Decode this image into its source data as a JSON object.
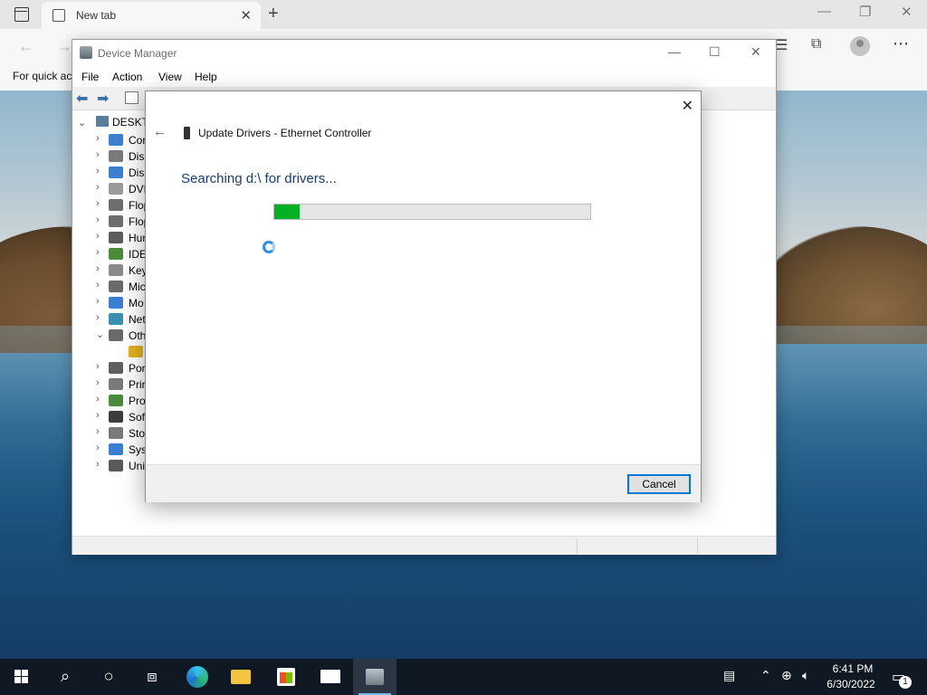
{
  "browser": {
    "tab_label": "New tab",
    "tab_close": "✕",
    "new_tab": "+",
    "favorites_text": "For quick ac"
  },
  "device_manager": {
    "title": "Device Manager",
    "menu": [
      "File",
      "Action",
      "View",
      "Help"
    ],
    "tree_root": "DESKTO",
    "tree_items": [
      {
        "label": "Cor",
        "chevron": "›",
        "icon_color": "#3c7fd1"
      },
      {
        "label": "Disl",
        "chevron": "›",
        "icon_color": "#7a7a7a"
      },
      {
        "label": "Disp",
        "chevron": "›",
        "icon_color": "#3c7fd1"
      },
      {
        "label": "DVD",
        "chevron": "›",
        "icon_color": "#9a9a9a"
      },
      {
        "label": "Flop",
        "chevron": "›",
        "icon_color": "#6e6e6e"
      },
      {
        "label": "Flop",
        "chevron": "›",
        "icon_color": "#6e6e6e"
      },
      {
        "label": "Hur",
        "chevron": "›",
        "icon_color": "#5b5b5b"
      },
      {
        "label": "IDE",
        "chevron": "›",
        "icon_color": "#4c8a3c"
      },
      {
        "label": "Key",
        "chevron": "›",
        "icon_color": "#8a8a8a"
      },
      {
        "label": "Mic",
        "chevron": "›",
        "icon_color": "#6a6a6a"
      },
      {
        "label": "Mo",
        "chevron": "›",
        "icon_color": "#3c7fd1"
      },
      {
        "label": "Net",
        "chevron": "›",
        "icon_color": "#3c8fb1"
      },
      {
        "label": "Oth",
        "chevron": "⌄",
        "icon_color": "#6a6a6a"
      },
      {
        "label": "",
        "chevron": "",
        "icon_color": "#e3b020"
      },
      {
        "label": "Por",
        "chevron": "›",
        "icon_color": "#5f5f5f"
      },
      {
        "label": "Prir",
        "chevron": "›",
        "icon_color": "#7a7a7a"
      },
      {
        "label": "Pro",
        "chevron": "›",
        "icon_color": "#4c8a3c"
      },
      {
        "label": "Sof",
        "chevron": "›",
        "icon_color": "#3d3d3d"
      },
      {
        "label": "Sto",
        "chevron": "›",
        "icon_color": "#7a7a7a"
      },
      {
        "label": "Sys",
        "chevron": "›",
        "icon_color": "#3c7fd1"
      },
      {
        "label": "Uni",
        "chevron": "›",
        "icon_color": "#5a5a5a"
      }
    ]
  },
  "dialog": {
    "title": "Update Drivers - Ethernet Controller",
    "heading": "Searching d:\\ for drivers...",
    "progress_percent": 8,
    "cancel_label": "Cancel",
    "close_glyph": "✕",
    "back_glyph": "←"
  },
  "taskbar": {
    "time": "6:41 PM",
    "date": "6/30/2022",
    "notification_count": "1"
  },
  "colors": {
    "progress_fill": "#06b025",
    "heading_text": "#1e3d6e",
    "taskbar_bg": "#101823",
    "accent": "#0078d7"
  }
}
